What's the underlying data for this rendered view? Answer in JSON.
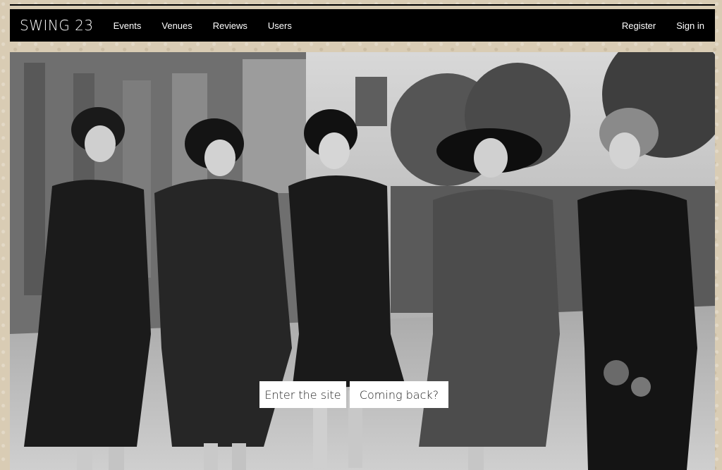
{
  "nav": {
    "brand": "SWING 23",
    "links": [
      "Events",
      "Venues",
      "Reviews",
      "Users"
    ],
    "register": "Register",
    "sign_in": "Sign in"
  },
  "hero": {
    "enter_label": "Enter the site",
    "back_label": "Coming back?"
  }
}
